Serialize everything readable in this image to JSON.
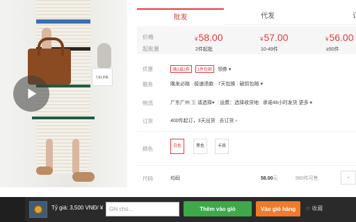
{
  "colors": {
    "accent": "#e4393c",
    "add_button": "#3ea84a",
    "cart_button": "#f07b2a",
    "bottom_bar": "#2a2a2a"
  },
  "tabs": [
    {
      "label": "批发",
      "active": true
    },
    {
      "label": "代发",
      "active": false
    },
    {
      "label": "订",
      "active": false
    }
  ],
  "price": {
    "price_label": "价格",
    "moq_label": "起批量",
    "currency": "¥",
    "tiers": [
      {
        "price": "58.00",
        "qty": "2件起批"
      },
      {
        "price": "57.00",
        "qty": "10-49件"
      },
      {
        "price": "56.00",
        "qty": "≥50件"
      }
    ]
  },
  "photo": {
    "shelf_label": "CELINE"
  },
  "offers": {
    "label": "优惠",
    "tags": [
      "满3减2券",
      "1件包邮"
    ],
    "link": "领券"
  },
  "service": {
    "label": "服务",
    "text": "晚发必赔 · 极速退款 · 7天包换 · 破损包赔"
  },
  "logistics": {
    "label": "物流",
    "from": "广东广州",
    "to_prefix": "至",
    "to": "请选择",
    "freight": "运费：选择收货地",
    "commit": "承诺48小时发货",
    "more": "更多"
  },
  "order": {
    "label": "订货",
    "text": "400件起订，3天出货",
    "link": "去订货"
  },
  "color": {
    "label": "颜色",
    "options": [
      "白色",
      "黑色",
      "卡其"
    ],
    "selected": 0
  },
  "size": {
    "label": "尺码",
    "name": "均码",
    "price": "58.00",
    "unit": "元",
    "stock": "980件可售",
    "stepper": "−"
  },
  "bottom_bar": {
    "rate_text": "Tỷ giá: 3,500 VNĐ/ ¥",
    "note_placeholder": "Ghi chú...",
    "add_button": "Thêm vào giỏ",
    "cart_button": "Vào giỏ hàng",
    "fav_text": "收藏"
  }
}
